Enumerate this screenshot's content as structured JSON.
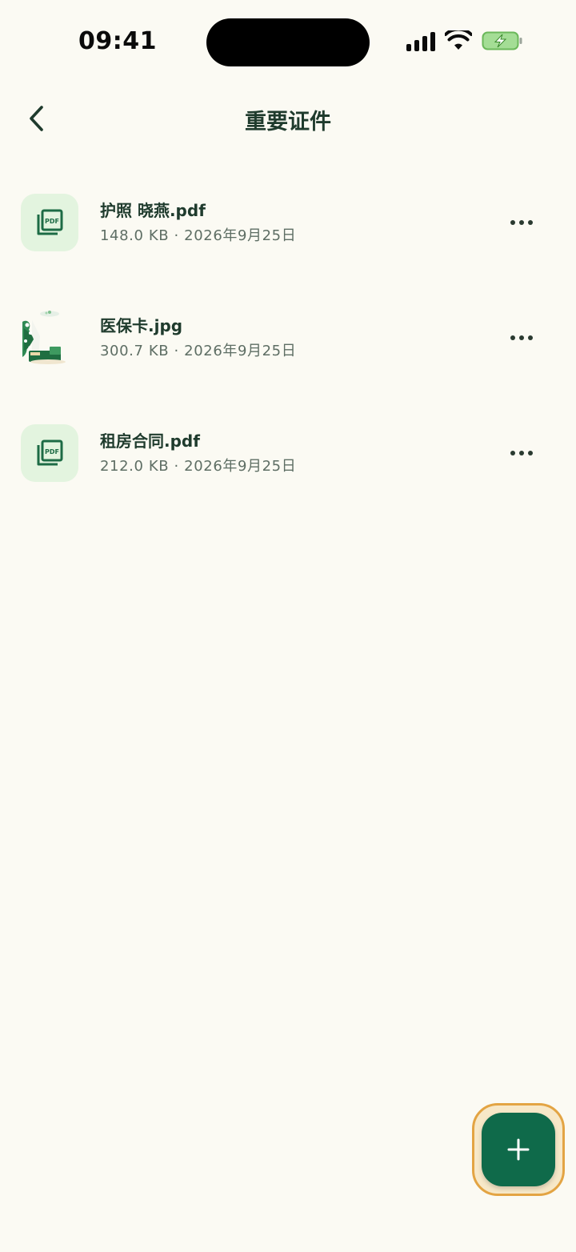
{
  "status_bar": {
    "time": "09:41"
  },
  "header": {
    "title": "重要证件"
  },
  "files": [
    {
      "name": "护照 晓燕.pdf",
      "meta": "148.0 KB · 2026年9月25日",
      "type": "pdf",
      "thumb_label": "PDF"
    },
    {
      "name": "医保卡.jpg",
      "meta": "300.7 KB · 2026年9月25日",
      "type": "image"
    },
    {
      "name": "租房合同.pdf",
      "meta": "212.0 KB · 2026年9月25日",
      "type": "pdf",
      "thumb_label": "PDF"
    }
  ],
  "icons": {
    "back": "chevron-left-icon",
    "more": "more-horizontal-icon",
    "add": "plus-icon",
    "pdf": "pdf-file-icon"
  },
  "colors": {
    "background": "#fbfaf3",
    "primary": "#0f6a4a",
    "pdf_tile": "#e3f4df",
    "fab_highlight": "#e3a443",
    "text_primary": "#1f3b2d",
    "text_secondary": "#5e6e64"
  }
}
